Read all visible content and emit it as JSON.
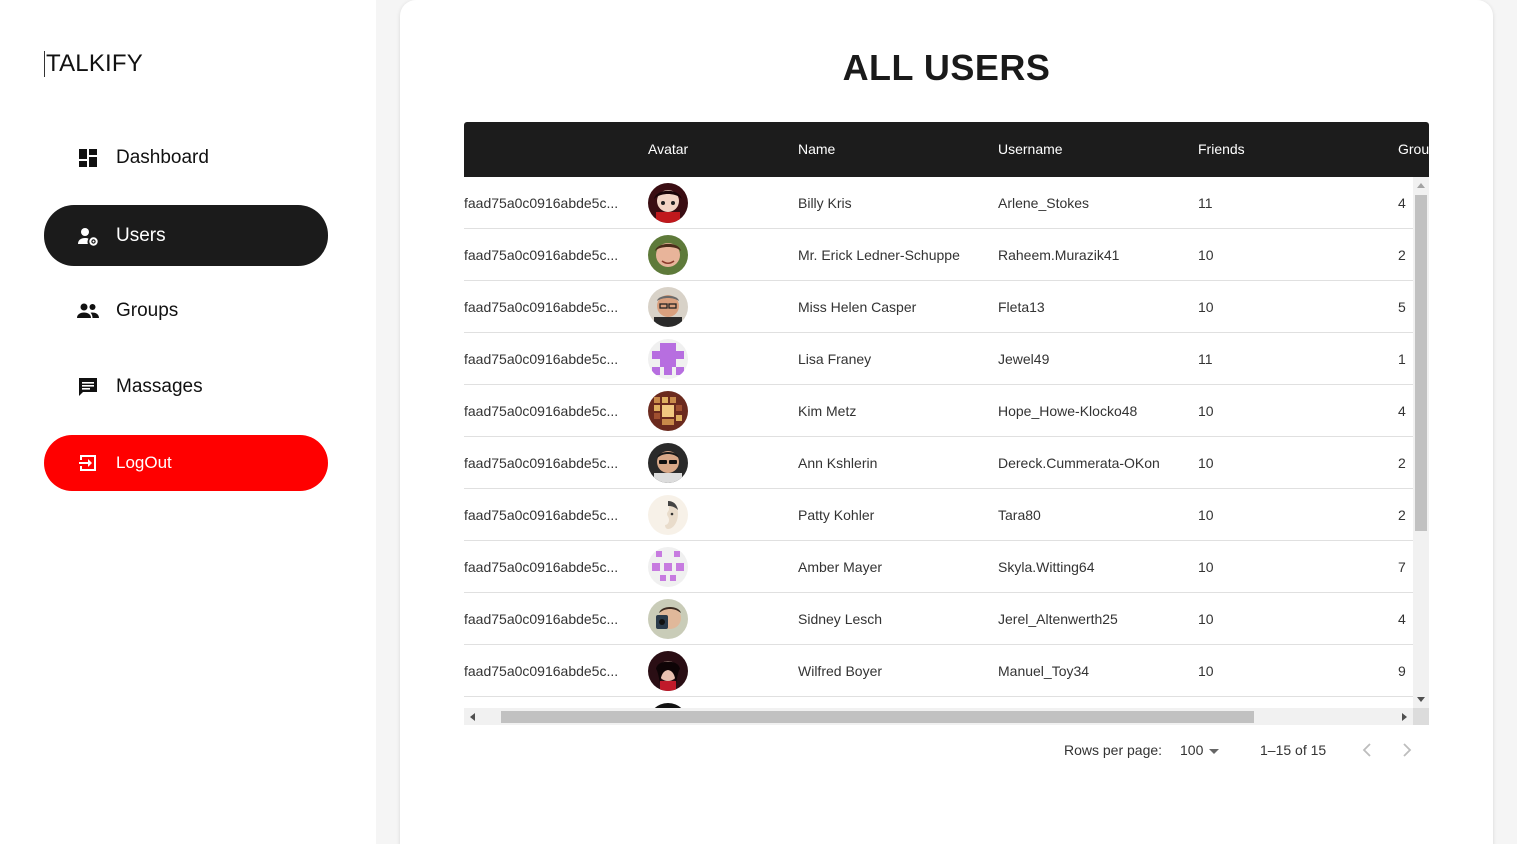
{
  "app": {
    "logo": "TALKIFY"
  },
  "sidebar": {
    "items": [
      {
        "label": "Dashboard",
        "icon": "dashboard-icon"
      },
      {
        "label": "Users",
        "icon": "manage-accounts-icon",
        "active": true
      },
      {
        "label": "Groups",
        "icon": "group-icon"
      },
      {
        "label": "Massages",
        "icon": "chat-icon"
      }
    ],
    "logout": {
      "label": "LogOut",
      "icon": "logout-icon",
      "color": "#ff0000"
    }
  },
  "main": {
    "title": "ALL USERS",
    "columns": [
      "",
      "Avatar",
      "Name",
      "Username",
      "Friends",
      "Grou"
    ],
    "rows": [
      {
        "id": "faad75a0c0916abde5c...",
        "avatar": "avatar-photo",
        "name": "Billy Kris",
        "username": "Arlene_Stokes",
        "friends": "11",
        "groups": "4"
      },
      {
        "id": "faad75a0c0916abde5c...",
        "avatar": "avatar-photo",
        "name": "Mr. Erick Ledner-Schuppe",
        "username": "Raheem.Murazik41",
        "friends": "10",
        "groups": "2"
      },
      {
        "id": "faad75a0c0916abde5c...",
        "avatar": "avatar-photo",
        "name": "Miss Helen Casper",
        "username": "Fleta13",
        "friends": "10",
        "groups": "5"
      },
      {
        "id": "faad75a0c0916abde5c...",
        "avatar": "avatar-identicon",
        "name": "Lisa Franey",
        "username": "Jewel49",
        "friends": "11",
        "groups": "1"
      },
      {
        "id": "faad75a0c0916abde5c...",
        "avatar": "avatar-photo",
        "name": "Kim Metz",
        "username": "Hope_Howe-Klocko48",
        "friends": "10",
        "groups": "4"
      },
      {
        "id": "faad75a0c0916abde5c...",
        "avatar": "avatar-photo",
        "name": "Ann Kshlerin",
        "username": "Dereck.Cummerata-OKon",
        "friends": "10",
        "groups": "2"
      },
      {
        "id": "faad75a0c0916abde5c...",
        "avatar": "avatar-photo",
        "name": "Patty Kohler",
        "username": "Tara80",
        "friends": "10",
        "groups": "2"
      },
      {
        "id": "faad75a0c0916abde5c...",
        "avatar": "avatar-identicon",
        "name": "Amber Mayer",
        "username": "Skyla.Witting64",
        "friends": "10",
        "groups": "7"
      },
      {
        "id": "faad75a0c0916abde5c...",
        "avatar": "avatar-photo",
        "name": "Sidney Lesch",
        "username": "Jerel_Altenwerth25",
        "friends": "10",
        "groups": "4"
      },
      {
        "id": "faad75a0c0916abde5c...",
        "avatar": "avatar-photo",
        "name": "Wilfred Boyer",
        "username": "Manuel_Toy34",
        "friends": "10",
        "groups": "9"
      }
    ],
    "pagination": {
      "rows_per_page_label": "Rows per page:",
      "rows_per_page": "100",
      "range": "1–15 of 15"
    }
  },
  "colors": {
    "accent_dark": "#1b1b1b",
    "logout_red": "#ff0000",
    "identicon_purple": "#b76ee0"
  }
}
